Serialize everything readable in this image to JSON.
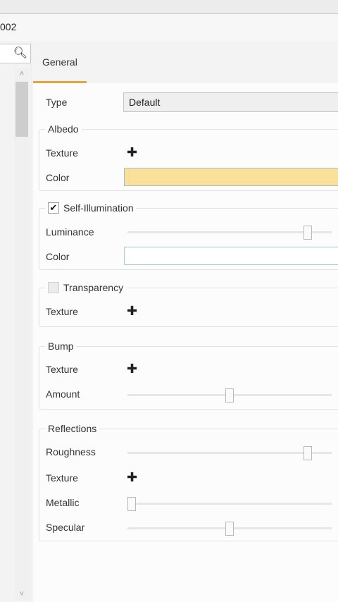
{
  "document": {
    "tab_label": "002"
  },
  "tabs": [
    {
      "label": "General",
      "active": true
    }
  ],
  "properties": {
    "type": {
      "label": "Type",
      "value": "Default"
    },
    "albedo": {
      "title": "Albedo",
      "texture_label": "Texture",
      "color_label": "Color",
      "color_value": "#fbe09a"
    },
    "self_illumination": {
      "title": "Self-Illumination",
      "checked": true,
      "luminance_label": "Luminance",
      "luminance_value": 0.9,
      "color_label": "Color",
      "color_value": "#ffffff"
    },
    "transparency": {
      "title": "Transparency",
      "checked": false,
      "texture_label": "Texture"
    },
    "bump": {
      "title": "Bump",
      "texture_label": "Texture",
      "amount_label": "Amount",
      "amount_value": 0.5
    },
    "reflections": {
      "title": "Reflections",
      "roughness_label": "Roughness",
      "roughness_value": 0.9,
      "texture_label": "Texture",
      "metallic_label": "Metallic",
      "metallic_value": 0.0,
      "specular_label": "Specular",
      "specular_value": 0.5
    }
  },
  "icons": {
    "search": "magnifier-icon",
    "add_texture": "plus-icon",
    "check": "check-icon"
  },
  "colors": {
    "accent": "#e8a33c"
  }
}
